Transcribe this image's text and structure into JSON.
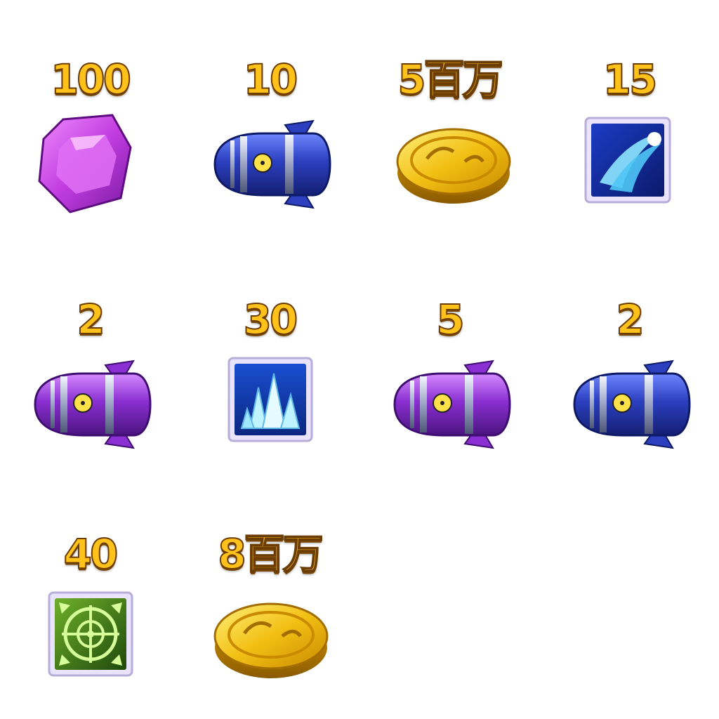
{
  "rewards": [
    {
      "quantity": "100",
      "icon": "purple-gem-icon"
    },
    {
      "quantity": "10",
      "icon": "blue-missile-icon"
    },
    {
      "quantity": "5百万",
      "icon": "gold-coin-icon"
    },
    {
      "quantity": "15",
      "icon": "ice-comet-skill-icon"
    },
    {
      "quantity": "2",
      "icon": "purple-missile-icon"
    },
    {
      "quantity": "30",
      "icon": "ice-crystal-skill-icon"
    },
    {
      "quantity": "5",
      "icon": "purple-missile-icon"
    },
    {
      "quantity": "2",
      "icon": "blue-missile-icon"
    },
    {
      "quantity": "40",
      "icon": "target-lock-skill-icon"
    },
    {
      "quantity": "8百万",
      "icon": "gold-coin-icon"
    }
  ],
  "colors": {
    "quantity_text": "#ffc21a",
    "quantity_outline": "#6b3d05",
    "gem": "#c13de0",
    "missile_blue": "#2b3fbf",
    "missile_purple": "#8a2fd1",
    "coin": "#f2c014",
    "skill_frame": "#d9d3f2"
  }
}
